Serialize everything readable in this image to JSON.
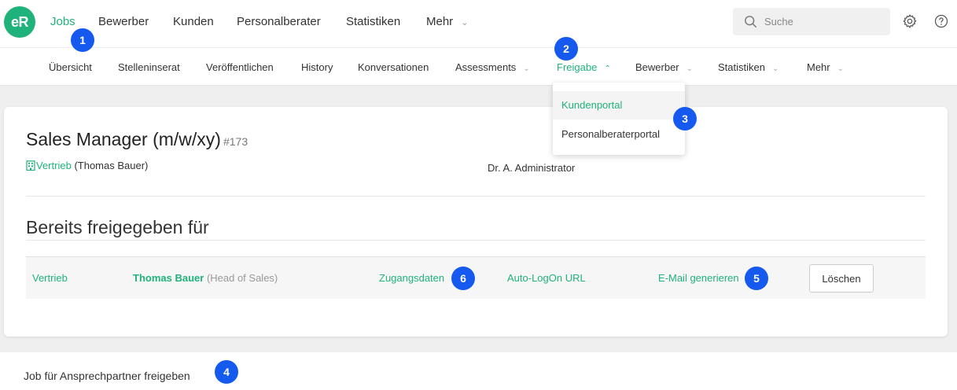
{
  "app": {
    "logo_text": "eR",
    "accent_color": "#1fb27a",
    "badge_color": "#1559ee"
  },
  "topnav": {
    "items": [
      "Jobs",
      "Bewerber",
      "Kunden",
      "Personalberater",
      "Statistiken",
      "Mehr"
    ],
    "active": "Jobs",
    "search_placeholder": "Suche",
    "icons": [
      "settings-gear-icon",
      "help-question-icon"
    ]
  },
  "subnav": {
    "items": [
      "Übersicht",
      "Stelleninserat",
      "Veröffentlichen",
      "History",
      "Konversationen",
      "Assessments",
      "Freigabe",
      "Bewerber",
      "Statistiken",
      "Mehr"
    ],
    "active": "Freigabe"
  },
  "dropdown": {
    "items": [
      "Kundenportal",
      "Personalberaterportal"
    ],
    "selected": "Kundenportal"
  },
  "job": {
    "title": "Sales Manager (m/w/xy)",
    "number": "#173",
    "department": "Vertrieb",
    "contact": "(Thomas Bauer)",
    "recruiter": "Dr. A. Administrator"
  },
  "shared": {
    "title": "Bereits freigegeben für",
    "rows": [
      {
        "department": "Vertrieb",
        "name": "Thomas Bauer",
        "role": "(Head of Sales)",
        "credentials": "Zugangsdaten",
        "autologon": "Auto-LogOn URL",
        "email": "E-Mail generieren",
        "delete": "Löschen"
      }
    ]
  },
  "bottom": {
    "text": "Job für Ansprechpartner freigeben"
  },
  "badges": [
    "1",
    "2",
    "3",
    "4",
    "5",
    "6"
  ]
}
